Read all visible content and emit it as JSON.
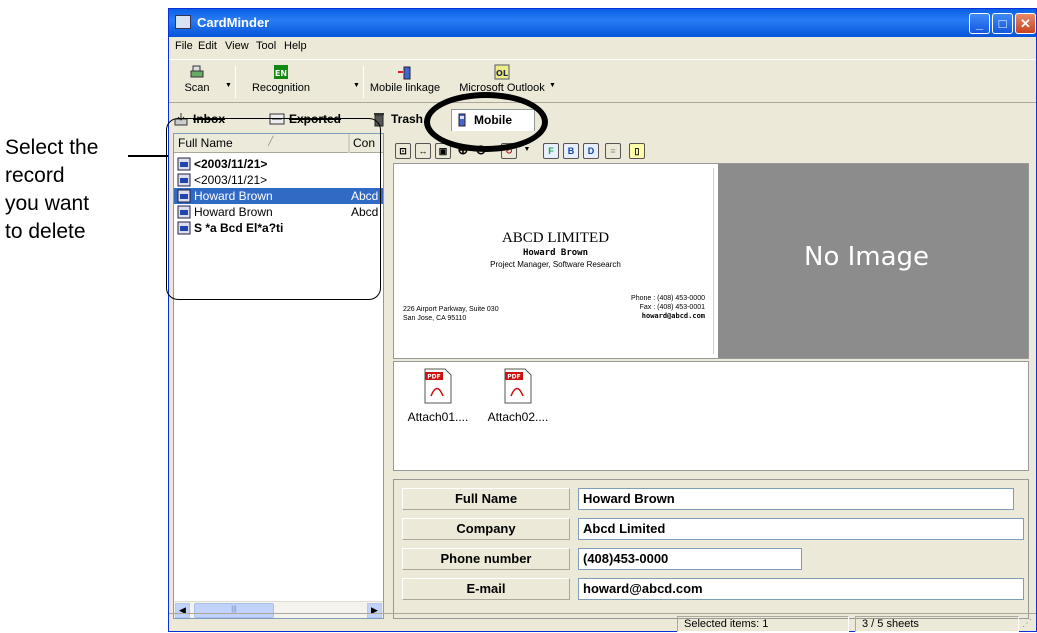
{
  "annotation": {
    "lines": [
      "Select the",
      "record",
      "you want",
      "to delete"
    ]
  },
  "window": {
    "title": "CardMinder"
  },
  "menu": [
    "File",
    "Edit",
    "View",
    "Tool",
    "Help"
  ],
  "toolbar": {
    "scan": "Scan",
    "recognition": "Recognition",
    "mobile_linkage": "Mobile linkage",
    "microsoft_outlook": "Microsoft Outlook"
  },
  "tabs": {
    "inbox": "Inbox",
    "exported": "Exported",
    "trash": "Trash",
    "mobile": "Mobile"
  },
  "list": {
    "col_fullname": "Full Name",
    "col_company": "Con",
    "rows": [
      {
        "name": "<2003/11/21>",
        "company": "",
        "bold": true
      },
      {
        "name": "<2003/11/21>",
        "company": "",
        "bold": false
      },
      {
        "name": "Howard Brown",
        "company": "Abcd",
        "bold": false
      },
      {
        "name": "Howard Brown",
        "company": "Abcd",
        "bold": false
      },
      {
        "name": "S *a Bcd El*a?ti",
        "company": "",
        "bold": true
      }
    ]
  },
  "card": {
    "company": "ABCD LIMITED",
    "person": "Howard Brown",
    "jobtitle": "Project Manager, Software Research",
    "address1": "226 Airport Parkway, Suite 030",
    "address2": "San Jose, CA 95110",
    "phone": "Phone : (408) 453-0000",
    "fax": "Fax : (408) 453-0001",
    "email": "howard@abcd.com",
    "no_image": "No Image"
  },
  "attachments": [
    "Attach01....",
    "Attach02...."
  ],
  "fields": {
    "full_name_label": "Full Name",
    "full_name_value": "Howard Brown",
    "company_label": "Company",
    "company_value": "Abcd Limited",
    "phone_label": "Phone number",
    "phone_value": "(408)453-0000",
    "email_label": "E-mail",
    "email_value": "howard@abcd.com"
  },
  "status": {
    "selected": "Selected items:  1",
    "sheets": "3 /   5 sheets"
  }
}
